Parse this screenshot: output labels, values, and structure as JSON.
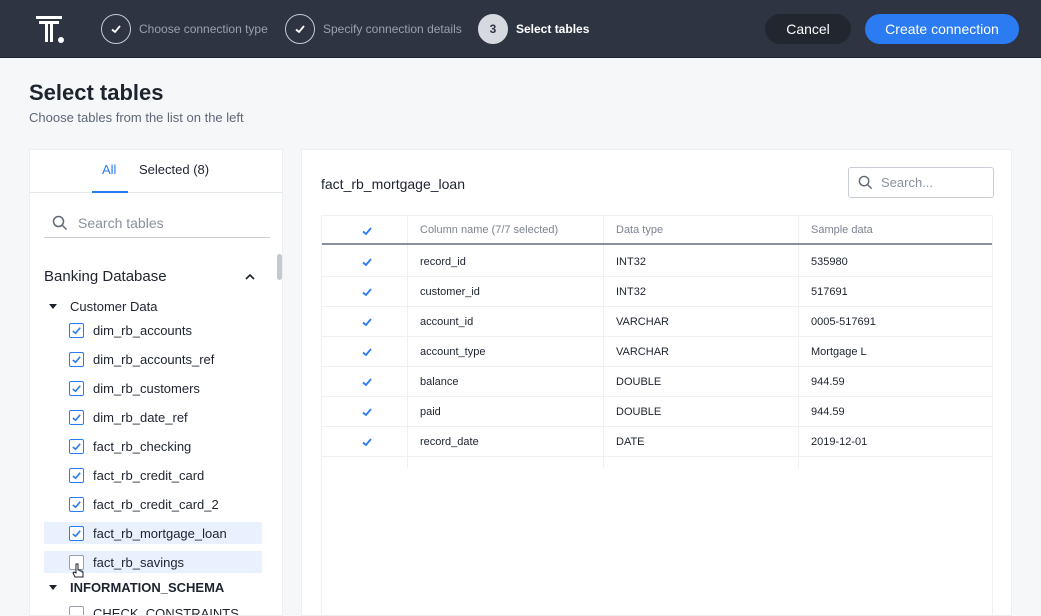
{
  "header": {
    "steps": [
      {
        "label": "Choose connection type",
        "state": "done"
      },
      {
        "label": "Specify connection details",
        "state": "done"
      },
      {
        "number": "3",
        "label": "Select tables",
        "state": "active"
      }
    ],
    "cancel_label": "Cancel",
    "create_label": "Create connection"
  },
  "page": {
    "title": "Select tables",
    "subtitle": "Choose tables from the list on the left"
  },
  "left_panel": {
    "tabs": [
      {
        "label": "All",
        "active": true
      },
      {
        "label": "Selected (8)",
        "active": false
      }
    ],
    "search_placeholder": "Search tables",
    "database": "Banking Database",
    "groups": [
      {
        "label": "Customer Data",
        "expanded": true
      },
      {
        "label": "INFORMATION_SCHEMA",
        "expanded": true
      }
    ],
    "tables": [
      {
        "label": "dim_rb_accounts",
        "checked": true
      },
      {
        "label": "dim_rb_accounts_ref",
        "checked": true
      },
      {
        "label": "dim_rb_customers",
        "checked": true
      },
      {
        "label": "dim_rb_date_ref",
        "checked": true
      },
      {
        "label": "fact_rb_checking",
        "checked": true
      },
      {
        "label": "fact_rb_credit_card",
        "checked": true
      },
      {
        "label": "fact_rb_credit_card_2",
        "checked": true
      },
      {
        "label": "fact_rb_mortgage_loan",
        "checked": true,
        "highlighted": true
      },
      {
        "label": "fact_rb_savings",
        "checked": false,
        "hover": true
      }
    ],
    "schema_tables": [
      {
        "label": "CHECK_CONSTRAINTS",
        "checked": false
      }
    ]
  },
  "right_panel": {
    "table_name": "fact_rb_mortgage_loan",
    "search_placeholder": "Search...",
    "columns_header": "Column name (7/7 selected)",
    "type_header": "Data type",
    "sample_header": "Sample data",
    "rows": [
      {
        "name": "record_id",
        "type": "INT32",
        "sample": "535980",
        "checked": true
      },
      {
        "name": "customer_id",
        "type": "INT32",
        "sample": "517691",
        "checked": true
      },
      {
        "name": "account_id",
        "type": "VARCHAR",
        "sample": "0005-517691",
        "checked": true
      },
      {
        "name": "account_type",
        "type": "VARCHAR",
        "sample": "Mortgage L",
        "checked": true
      },
      {
        "name": "balance",
        "type": "DOUBLE",
        "sample": "944.59",
        "checked": true
      },
      {
        "name": "paid",
        "type": "DOUBLE",
        "sample": "944.59",
        "checked": true
      },
      {
        "name": "record_date",
        "type": "DATE",
        "sample": "2019-12-01",
        "checked": true
      }
    ]
  },
  "colors": {
    "accent": "#2b7bf2",
    "topbar": "#2f3442",
    "highlight": "#e8f1fd"
  }
}
